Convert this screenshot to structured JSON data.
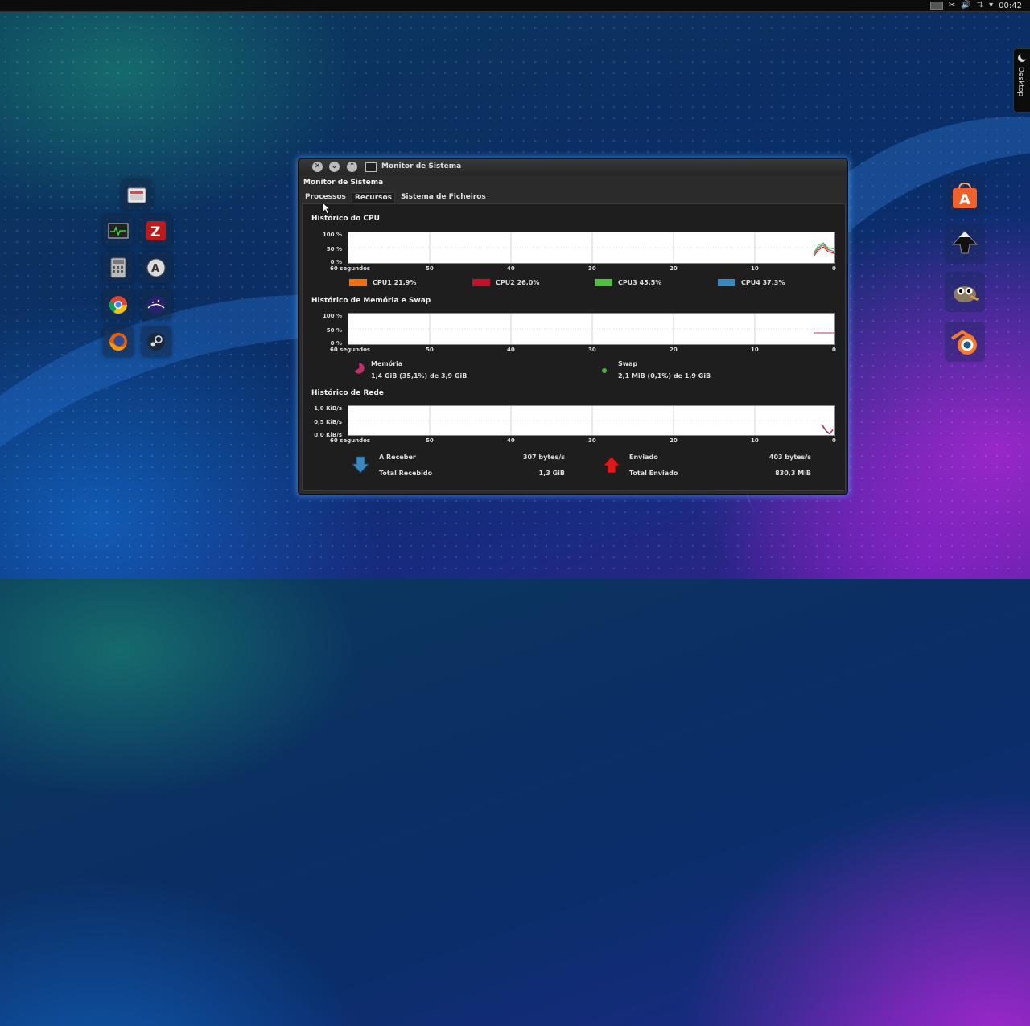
{
  "window": {
    "title": "Monitor de Sistema",
    "menubar_title": "Monitor de Sistema",
    "tabs": [
      "Processos",
      "Recursos",
      "Sistema de Ficheiros"
    ],
    "active_tab": "Recursos"
  },
  "tray": {
    "clock": "00:42"
  },
  "desktop_tab": {
    "label": "Desktop"
  },
  "cpu": {
    "heading": "Histórico do CPU",
    "y_ticks": [
      "100 %",
      "50 %",
      "0 %"
    ],
    "x_ticks": [
      "60 segundos",
      "50",
      "40",
      "30",
      "20",
      "10",
      "0"
    ],
    "legend": [
      {
        "label": "CPU1  21,9%",
        "color": "#f07010"
      },
      {
        "label": "CPU2  26,0%",
        "color": "#c8102e"
      },
      {
        "label": "CPU3  45,5%",
        "color": "#50c040"
      },
      {
        "label": "CPU4  37,3%",
        "color": "#3a88c0"
      }
    ]
  },
  "memory": {
    "heading": "Histórico de Memória e Swap",
    "y_ticks": [
      "100 %",
      "50 %",
      "0 %"
    ],
    "x_ticks": [
      "60 segundos",
      "50",
      "40",
      "30",
      "20",
      "10",
      "0"
    ],
    "mem_label": "Memória",
    "mem_value": "1,4 GiB (35,1%) de 3,9 GiB",
    "mem_color": "#c0306a",
    "swap_label": "Swap",
    "swap_value": "2,1 MiB (0,1%) de 1,9 GiB",
    "swap_color": "#50b040"
  },
  "network": {
    "heading": "Histórico de Rede",
    "y_ticks": [
      "1,0 KiB/s",
      "0,5 KiB/s",
      "0,0 KiB/s"
    ],
    "x_ticks": [
      "60 segundos",
      "50",
      "40",
      "30",
      "20",
      "10",
      "0"
    ],
    "recv_label": "A Receber",
    "recv_rate": "307 bytes/s",
    "recv_total_label": "Total Recebido",
    "recv_total": "1,3 GiB",
    "sent_label": "Enviado",
    "sent_rate": "403 bytes/s",
    "sent_total_label": "Total Enviado",
    "sent_total": "830,3 MiB"
  },
  "dock_left": [
    "file-manager-icon",
    "system-monitor-icon",
    "filezilla-icon",
    "calculator-icon",
    "software-center-icon",
    "chrome-icon",
    "stellarium-icon",
    "firefox-icon",
    "steam-icon"
  ],
  "dock_right": [
    "app-store-icon",
    "inkscape-icon",
    "gimp-icon",
    "blender-icon"
  ]
}
